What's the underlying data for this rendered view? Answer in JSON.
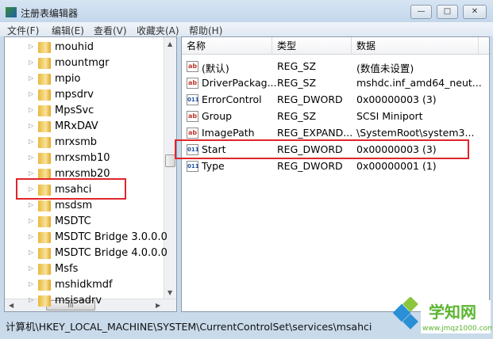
{
  "window": {
    "title": "注册表编辑器",
    "minimize": "—",
    "maximize": "□",
    "close": "✕"
  },
  "menu": [
    "文件(F)",
    "编辑(E)",
    "查看(V)",
    "收藏夹(A)",
    "帮助(H)"
  ],
  "tree": [
    "mouhid",
    "mountmgr",
    "mpio",
    "mpsdrv",
    "MpsSvc",
    "MRxDAV",
    "mrxsmb",
    "mrxsmb10",
    "mrxsmb20",
    "msahci",
    "msdsm",
    "MSDTC",
    "MSDTC Bridge 3.0.0.0",
    "MSDTC Bridge 4.0.0.0",
    "Msfs",
    "mshidkmdf",
    "msisadrv"
  ],
  "selected_key": "msahci",
  "columns": [
    "名称",
    "类型",
    "数据"
  ],
  "values": [
    {
      "name": "(默认)",
      "type": "REG_SZ",
      "data": "(数值未设置)",
      "icon": "ab"
    },
    {
      "name": "DriverPackag...",
      "type": "REG_SZ",
      "data": "mshdc.inf_amd64_neut...",
      "icon": "ab"
    },
    {
      "name": "ErrorControl",
      "type": "REG_DWORD",
      "data": "0x00000003 (3)",
      "icon": "011"
    },
    {
      "name": "Group",
      "type": "REG_SZ",
      "data": "SCSI Miniport",
      "icon": "ab"
    },
    {
      "name": "ImagePath",
      "type": "REG_EXPAND...",
      "data": "\\SystemRoot\\system3...",
      "icon": "ab"
    },
    {
      "name": "Start",
      "type": "REG_DWORD",
      "data": "0x00000003 (3)",
      "icon": "011"
    },
    {
      "name": "Type",
      "type": "REG_DWORD",
      "data": "0x00000001 (1)",
      "icon": "011"
    }
  ],
  "status": "计算机\\HKEY_LOCAL_MACHINE\\SYSTEM\\CurrentControlSet\\services\\msahci",
  "watermark": {
    "name": "学知网",
    "url": "www.jmqz1000.com"
  },
  "colors": {
    "highlight": "#e0252b"
  }
}
